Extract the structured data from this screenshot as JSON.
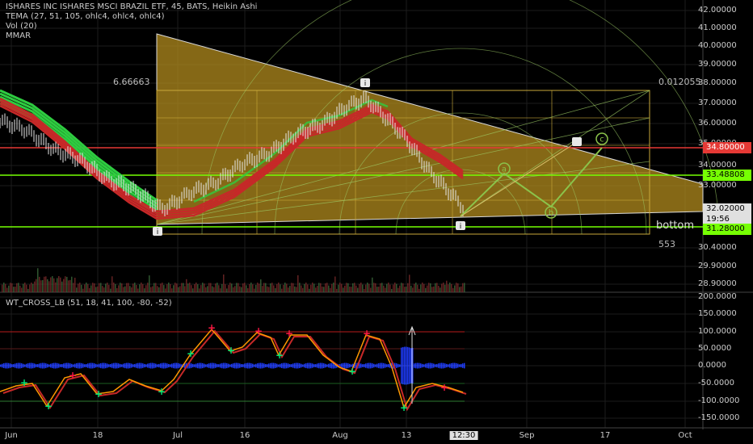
{
  "main_legend": {
    "title": "ISHARES INC ISHARES MSCI BRAZIL ETF, 45, BATS, Heikin Ashi",
    "tema": "TEMA (27, 51, 105, ohlc4, ohlc4, ohlc4)",
    "vol": "Vol (20)",
    "mmar": "MMAR"
  },
  "osc_legend": "WT_CROSS_LB (51, 18, 41, 100, -80, -52)",
  "price_axis": [
    "42.00000",
    "41.00000",
    "40.00000",
    "39.00000",
    "38.00000",
    "37.00000",
    "36.00000",
    "35.00000",
    "34.00000",
    "33.00000",
    "30.40000",
    "29.90000",
    "28.90000"
  ],
  "price_tags": {
    "red": "34.80000",
    "green_upper": "33.48808",
    "current": "32.02000",
    "timer": "19:56",
    "green_lower": "31.28000"
  },
  "osc_axis": [
    "200.0000",
    "150.0000",
    "100.0000",
    "50.0000",
    "0.0000",
    "-50.0000",
    "-100.0000",
    "-150.0000"
  ],
  "x_axis": [
    "Jun",
    "18",
    "Jul",
    "16",
    "Aug",
    "13",
    "12:30",
    "Sep",
    "17",
    "Oct"
  ],
  "annotations": {
    "fib_left": "6.66663",
    "fib_right": "0.012055",
    "bottom_label": "bottom",
    "count": "553",
    "wave_a": "a",
    "wave_b": "b",
    "wave_c": "c",
    "marker_i": "i"
  },
  "colors": {
    "background": "#000000",
    "triangle_fill": "#b8901e",
    "red_line": "#e53935",
    "green_line": "#76ff03",
    "wave_green": "#8bc34a",
    "ribbon_green": "#2ecc40",
    "ribbon_red": "#c62828",
    "blue_hist": "#1e3cff"
  }
}
